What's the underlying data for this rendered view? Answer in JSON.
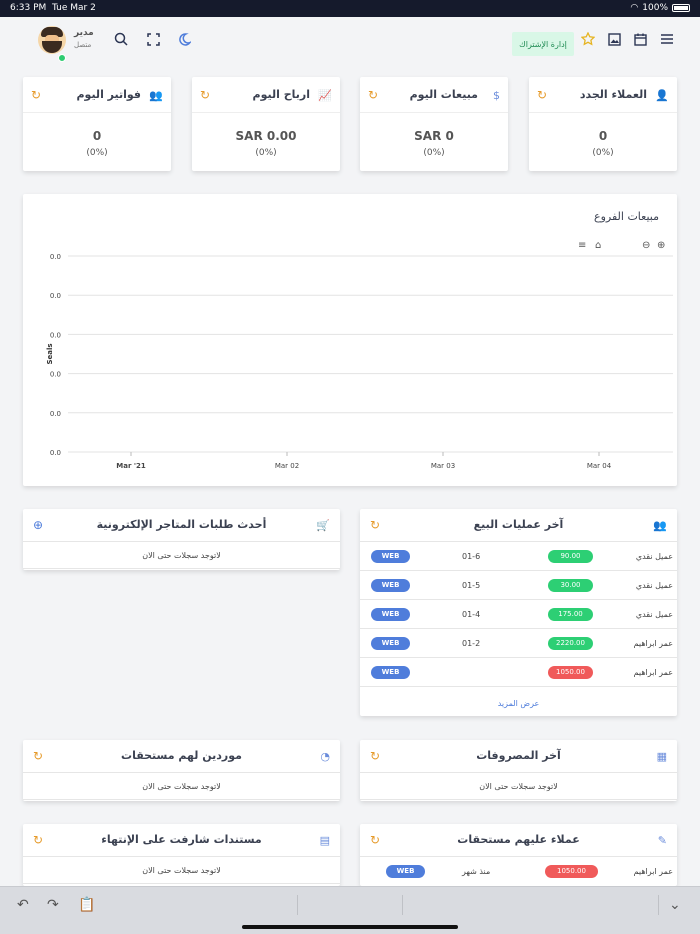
{
  "status_bar": {
    "time": "6:33 PM",
    "date": "Tue Mar 2",
    "battery": "100%"
  },
  "header": {
    "user_name": "مدير",
    "user_status": "متصل",
    "subscription_button": "إدارة الإشتراك"
  },
  "stats": [
    {
      "title": "العملاء الجدد",
      "value": "0",
      "percent": "(0%)"
    },
    {
      "title": "مبيعات اليوم",
      "value": "SAR 0",
      "percent": "(0%)"
    },
    {
      "title": "ارباح اليوم",
      "value": "SAR 0.00",
      "percent": "(0%)"
    },
    {
      "title": "فواتير اليوم",
      "value": "0",
      "percent": "(0%)"
    }
  ],
  "chart_data": {
    "type": "line",
    "title": "مبيعات الفروع",
    "ylabel": "Seals",
    "x_ticks": [
      "Mar '21",
      "Mar 02",
      "Mar 03",
      "Mar 04"
    ],
    "y_ticks": [
      "0.0",
      "0.0",
      "0.0",
      "0.0",
      "0.0",
      "0.0"
    ],
    "series": [],
    "grid": true
  },
  "sales": {
    "title": "آخر عمليات البيع",
    "rows": [
      {
        "customer": "عميل نقدي",
        "amount": "90.00",
        "status": "green",
        "date": "01-6",
        "source": "WEB"
      },
      {
        "customer": "عميل نقدي",
        "amount": "30.00",
        "status": "green",
        "date": "01-5",
        "source": "WEB"
      },
      {
        "customer": "عميل نقدي",
        "amount": "175.00",
        "status": "green",
        "date": "01-4",
        "source": "WEB"
      },
      {
        "customer": "عمر ابراهيم",
        "amount": "2220.00",
        "status": "green",
        "date": "01-2",
        "source": "WEB"
      },
      {
        "customer": "عمر ابراهيم",
        "amount": "1050.00",
        "status": "red",
        "date": "",
        "source": "WEB"
      }
    ],
    "more_link": "عرض المزيد"
  },
  "orders": {
    "title": "أحدث طلبات المتاجر الإلكترونية",
    "empty": "لاتوجد سجلات حتى الان"
  },
  "expenses": {
    "title": "آخر المصروفات",
    "empty": "لاتوجد سجلات حتى الان"
  },
  "suppliers": {
    "title": "موردين لهم مستحقات",
    "empty": "لاتوجد سجلات حتى الان"
  },
  "debtors": {
    "title": "عملاء عليهم مستحقات",
    "rows": [
      {
        "customer": "عمر ابراهيم",
        "amount": "1050.00",
        "since": "منذ شهر",
        "source": "WEB"
      }
    ]
  },
  "documents": {
    "title": "مستندات شارفت على الإنتهاء",
    "empty": "لاتوجد سجلات حتى الان"
  },
  "colors": {
    "accent": "#4f7ddb",
    "positive": "#2dcf74",
    "negative": "#f05a5a",
    "refresh": "#e69b2b"
  }
}
